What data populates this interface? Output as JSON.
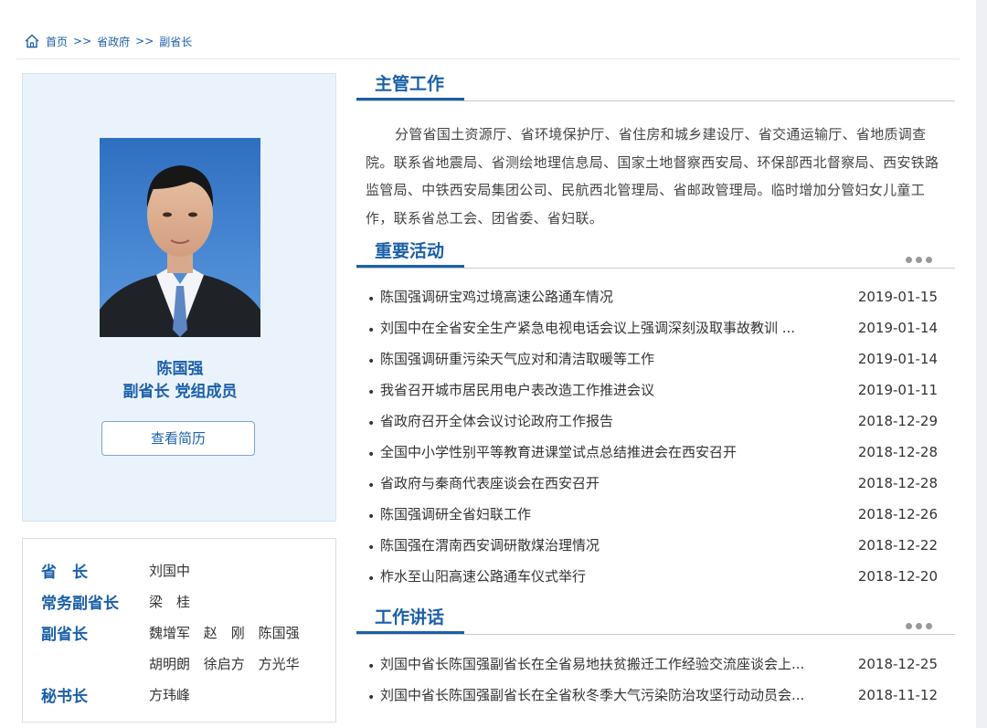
{
  "breadcrumb": {
    "home": "首页",
    "sep1": ">>",
    "gov": "省政府",
    "sep2": ">>",
    "current": "副省长"
  },
  "profile": {
    "name": "陈国强",
    "title": "副省长 党组成员",
    "resume_button": "查看简历"
  },
  "leaders": [
    {
      "role": "省　长",
      "names": [
        "刘国中"
      ]
    },
    {
      "role": "常务副省长",
      "names": [
        "梁　桂"
      ]
    },
    {
      "role": "副省长",
      "names": [
        "魏增军",
        "赵　刚",
        "陈国强"
      ]
    },
    {
      "role": "",
      "names": [
        "胡明朗",
        "徐启方",
        "方光华"
      ]
    },
    {
      "role": "秘书长",
      "names": [
        "方玮峰"
      ]
    }
  ],
  "duty": {
    "heading": "主管工作",
    "text": "分管省国土资源厅、省环境保护厅、省住房和城乡建设厅、省交通运输厅、省地质调查院。联系省地震局、省测绘地理信息局、国家土地督察西安局、环保部西北督察局、西安铁路监管局、中铁西安局集团公司、民航西北管理局、省邮政管理局。临时增加分管妇女儿童工作，联系省总工会、团省委、省妇联。"
  },
  "activities": {
    "heading": "重要活动",
    "items": [
      {
        "text": "陈国强调研宝鸡过境高速公路通车情况",
        "date": "2019-01-15"
      },
      {
        "text": "刘国中在全省安全生产紧急电视电话会议上强调深刻汲取事故教训 ...",
        "date": "2019-01-14"
      },
      {
        "text": "陈国强调研重污染天气应对和清洁取暖等工作",
        "date": "2019-01-14"
      },
      {
        "text": "我省召开城市居民用电户表改造工作推进会议",
        "date": "2019-01-11"
      },
      {
        "text": "省政府召开全体会议讨论政府工作报告",
        "date": "2018-12-29"
      },
      {
        "text": "全国中小学性别平等教育进课堂试点总结推进会在西安召开",
        "date": "2018-12-28"
      },
      {
        "text": "省政府与秦商代表座谈会在西安召开",
        "date": "2018-12-28"
      },
      {
        "text": "陈国强调研全省妇联工作",
        "date": "2018-12-26"
      },
      {
        "text": "陈国强在渭南西安调研散煤治理情况",
        "date": "2018-12-22"
      },
      {
        "text": "柞水至山阳高速公路通车仪式举行",
        "date": "2018-12-20"
      }
    ]
  },
  "speeches": {
    "heading": "工作讲话",
    "items": [
      {
        "text": "刘国中省长陈国强副省长在全省易地扶贫搬迁工作经验交流座谈会上...",
        "date": "2018-12-25"
      },
      {
        "text": "刘国中省长陈国强副省长在全省秋冬季大气污染防治攻坚行动动员会...",
        "date": "2018-11-12"
      }
    ]
  },
  "icons": {
    "home": "home-icon",
    "more": "more-dots-icon"
  },
  "colors": {
    "accent": "#1b5fa8",
    "profile_bg": "#eaf3fc"
  }
}
